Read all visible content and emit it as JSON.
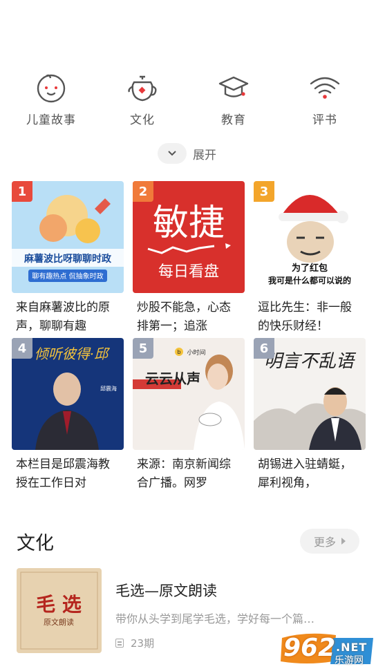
{
  "categories": [
    {
      "label": "儿童故事",
      "icon": "child-face-icon"
    },
    {
      "label": "文化",
      "icon": "teapot-icon"
    },
    {
      "label": "教育",
      "icon": "graduation-cap-icon"
    },
    {
      "label": "评书",
      "icon": "radio-waves-icon"
    }
  ],
  "expand": {
    "label": "展开"
  },
  "ranking": [
    {
      "rank": "1",
      "title": "来自麻薯波比的原声，聊聊有趣",
      "cover_text": "麻薯波比呀聊聊时政",
      "cover_sub": "聊有趣热点 侃抽象时政"
    },
    {
      "rank": "2",
      "title": "炒股不能急，心态排第一；追涨",
      "cover_text": "敏捷",
      "cover_sub": "每日看盘"
    },
    {
      "rank": "3",
      "title": "逗比先生：非一般的快乐财经！",
      "cover_text": "为了红包",
      "cover_sub": "我可是什么都可以说的"
    },
    {
      "rank": "4",
      "title": "本栏目是邱震海教授在工作日对",
      "cover_text": "倾听彼得·邱",
      "cover_sub": "邱震海"
    },
    {
      "rank": "5",
      "title": "来源：南京新闻综合广播。网罗",
      "cover_text": "云云从声",
      "cover_sub": "小时间"
    },
    {
      "rank": "6",
      "title": "胡锡进入驻蜻蜓，犀利视角，",
      "cover_text": "明言不乱语",
      "cover_sub": ""
    }
  ],
  "section": {
    "title": "文化",
    "more_label": "更多"
  },
  "album": {
    "title": "毛选—原文朗读",
    "description": "带你从头学到尾学毛选，学好每一个篇…",
    "episodes": "23期",
    "cover_title": "毛 选",
    "cover_sub": "原文朗读"
  },
  "watermark": {
    "number": "962",
    "domain": ".NET",
    "site": "乐游网"
  },
  "colors": {
    "rank1": "#e84a3c",
    "rank2": "#f07a3a",
    "rank3": "#f3a52b",
    "rank_other": "#9aa3b5",
    "accent": "#e8393b"
  }
}
